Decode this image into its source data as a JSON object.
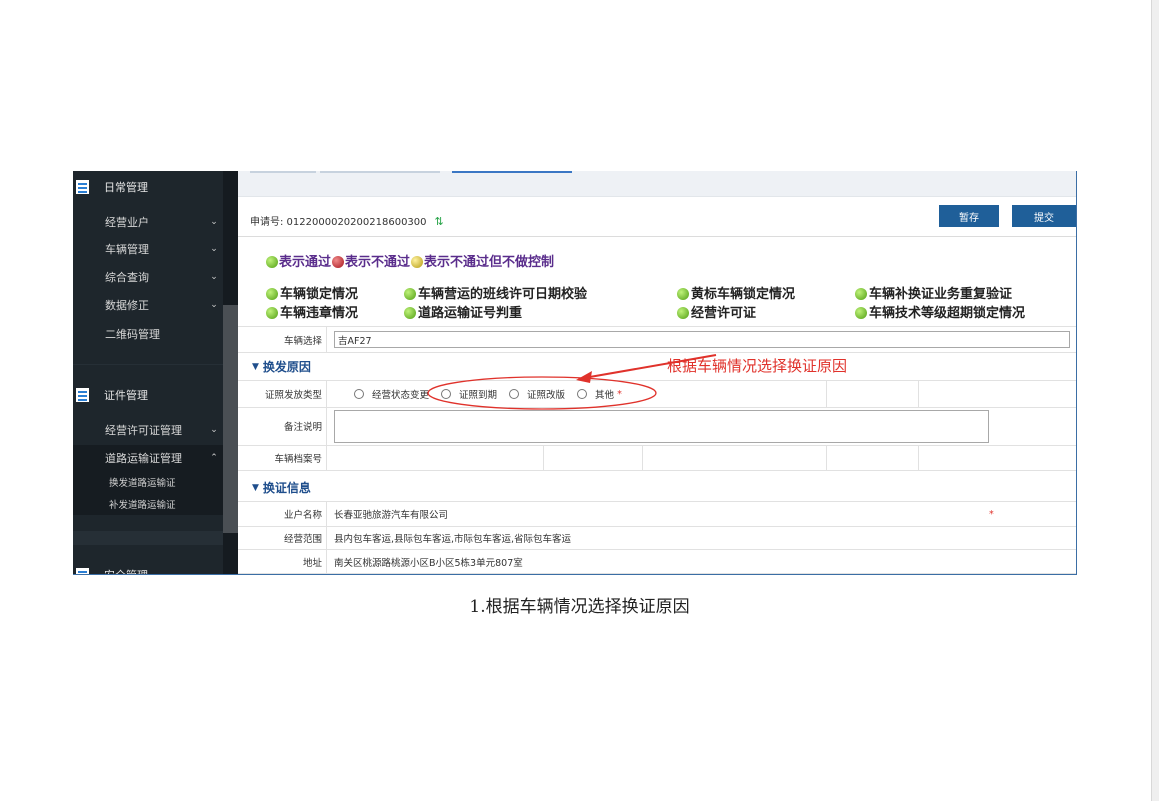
{
  "sidebar": {
    "section_daily": "日常管理",
    "items": [
      {
        "label": "经营业户"
      },
      {
        "label": "车辆管理"
      },
      {
        "label": "综合查询"
      },
      {
        "label": "数据修正"
      },
      {
        "label": "二维码管理"
      }
    ],
    "section_cert": "证件管理",
    "cert_items": [
      {
        "label": "经营许可证管理"
      },
      {
        "label": "道路运输证管理"
      }
    ],
    "sub_items": [
      {
        "label": "换发道路运输证"
      },
      {
        "label": "补发道路运输证"
      }
    ],
    "section_partial": "安全管理"
  },
  "toolbar": {
    "app_no": "申请号: 0122000020200218600300",
    "save_label": "暂存",
    "submit_label": "提交"
  },
  "legend": {
    "pass": "表示通过",
    "fail": "表示不通过",
    "fail_no_control": "表示不通过但不做控制"
  },
  "checks": {
    "lock": "车辆锁定情况",
    "shift": "车辆营运的班线许可日期校验",
    "yellow": "黄标车辆锁定情况",
    "reissue": "车辆补换证业务重复验证",
    "violation": "车辆违章情况",
    "road_cert": "道路运输证号判重",
    "license": "经营许可证",
    "tech": "车辆技术等级超期锁定情况"
  },
  "form": {
    "vehicle_label": "车辆选择",
    "vehicle_value": "吉AF27",
    "reason_section": "换发原因",
    "type_label": "证照发放类型",
    "options": [
      "经营状态变更",
      "证照到期",
      "证照改版",
      "其他"
    ],
    "required_mark": "*",
    "remark_label": "备注说明",
    "archive_label": "车辆档案号",
    "cert_section": "换证信息",
    "owner_label": "业户名称",
    "owner_value": "长春亚驰旅游汽车有限公司",
    "scope_label": "经营范围",
    "scope_value": "县内包车客运,县际包车客运,市际包车客运,省际包车客运",
    "address_label": "地址",
    "address_value": "南关区桃源路桃源小区B小区5栋3单元807室"
  },
  "annotation": "根据车辆情况选择换证原因",
  "caption": "1.根据车辆情况选择换证原因",
  "colors": {
    "sidebar_bg": "#1e262c",
    "button_bg": "#1f5f99",
    "annotation_red": "#e0322b",
    "legend_purple": "#5a2d8c",
    "section_blue": "#1f4e8c"
  }
}
